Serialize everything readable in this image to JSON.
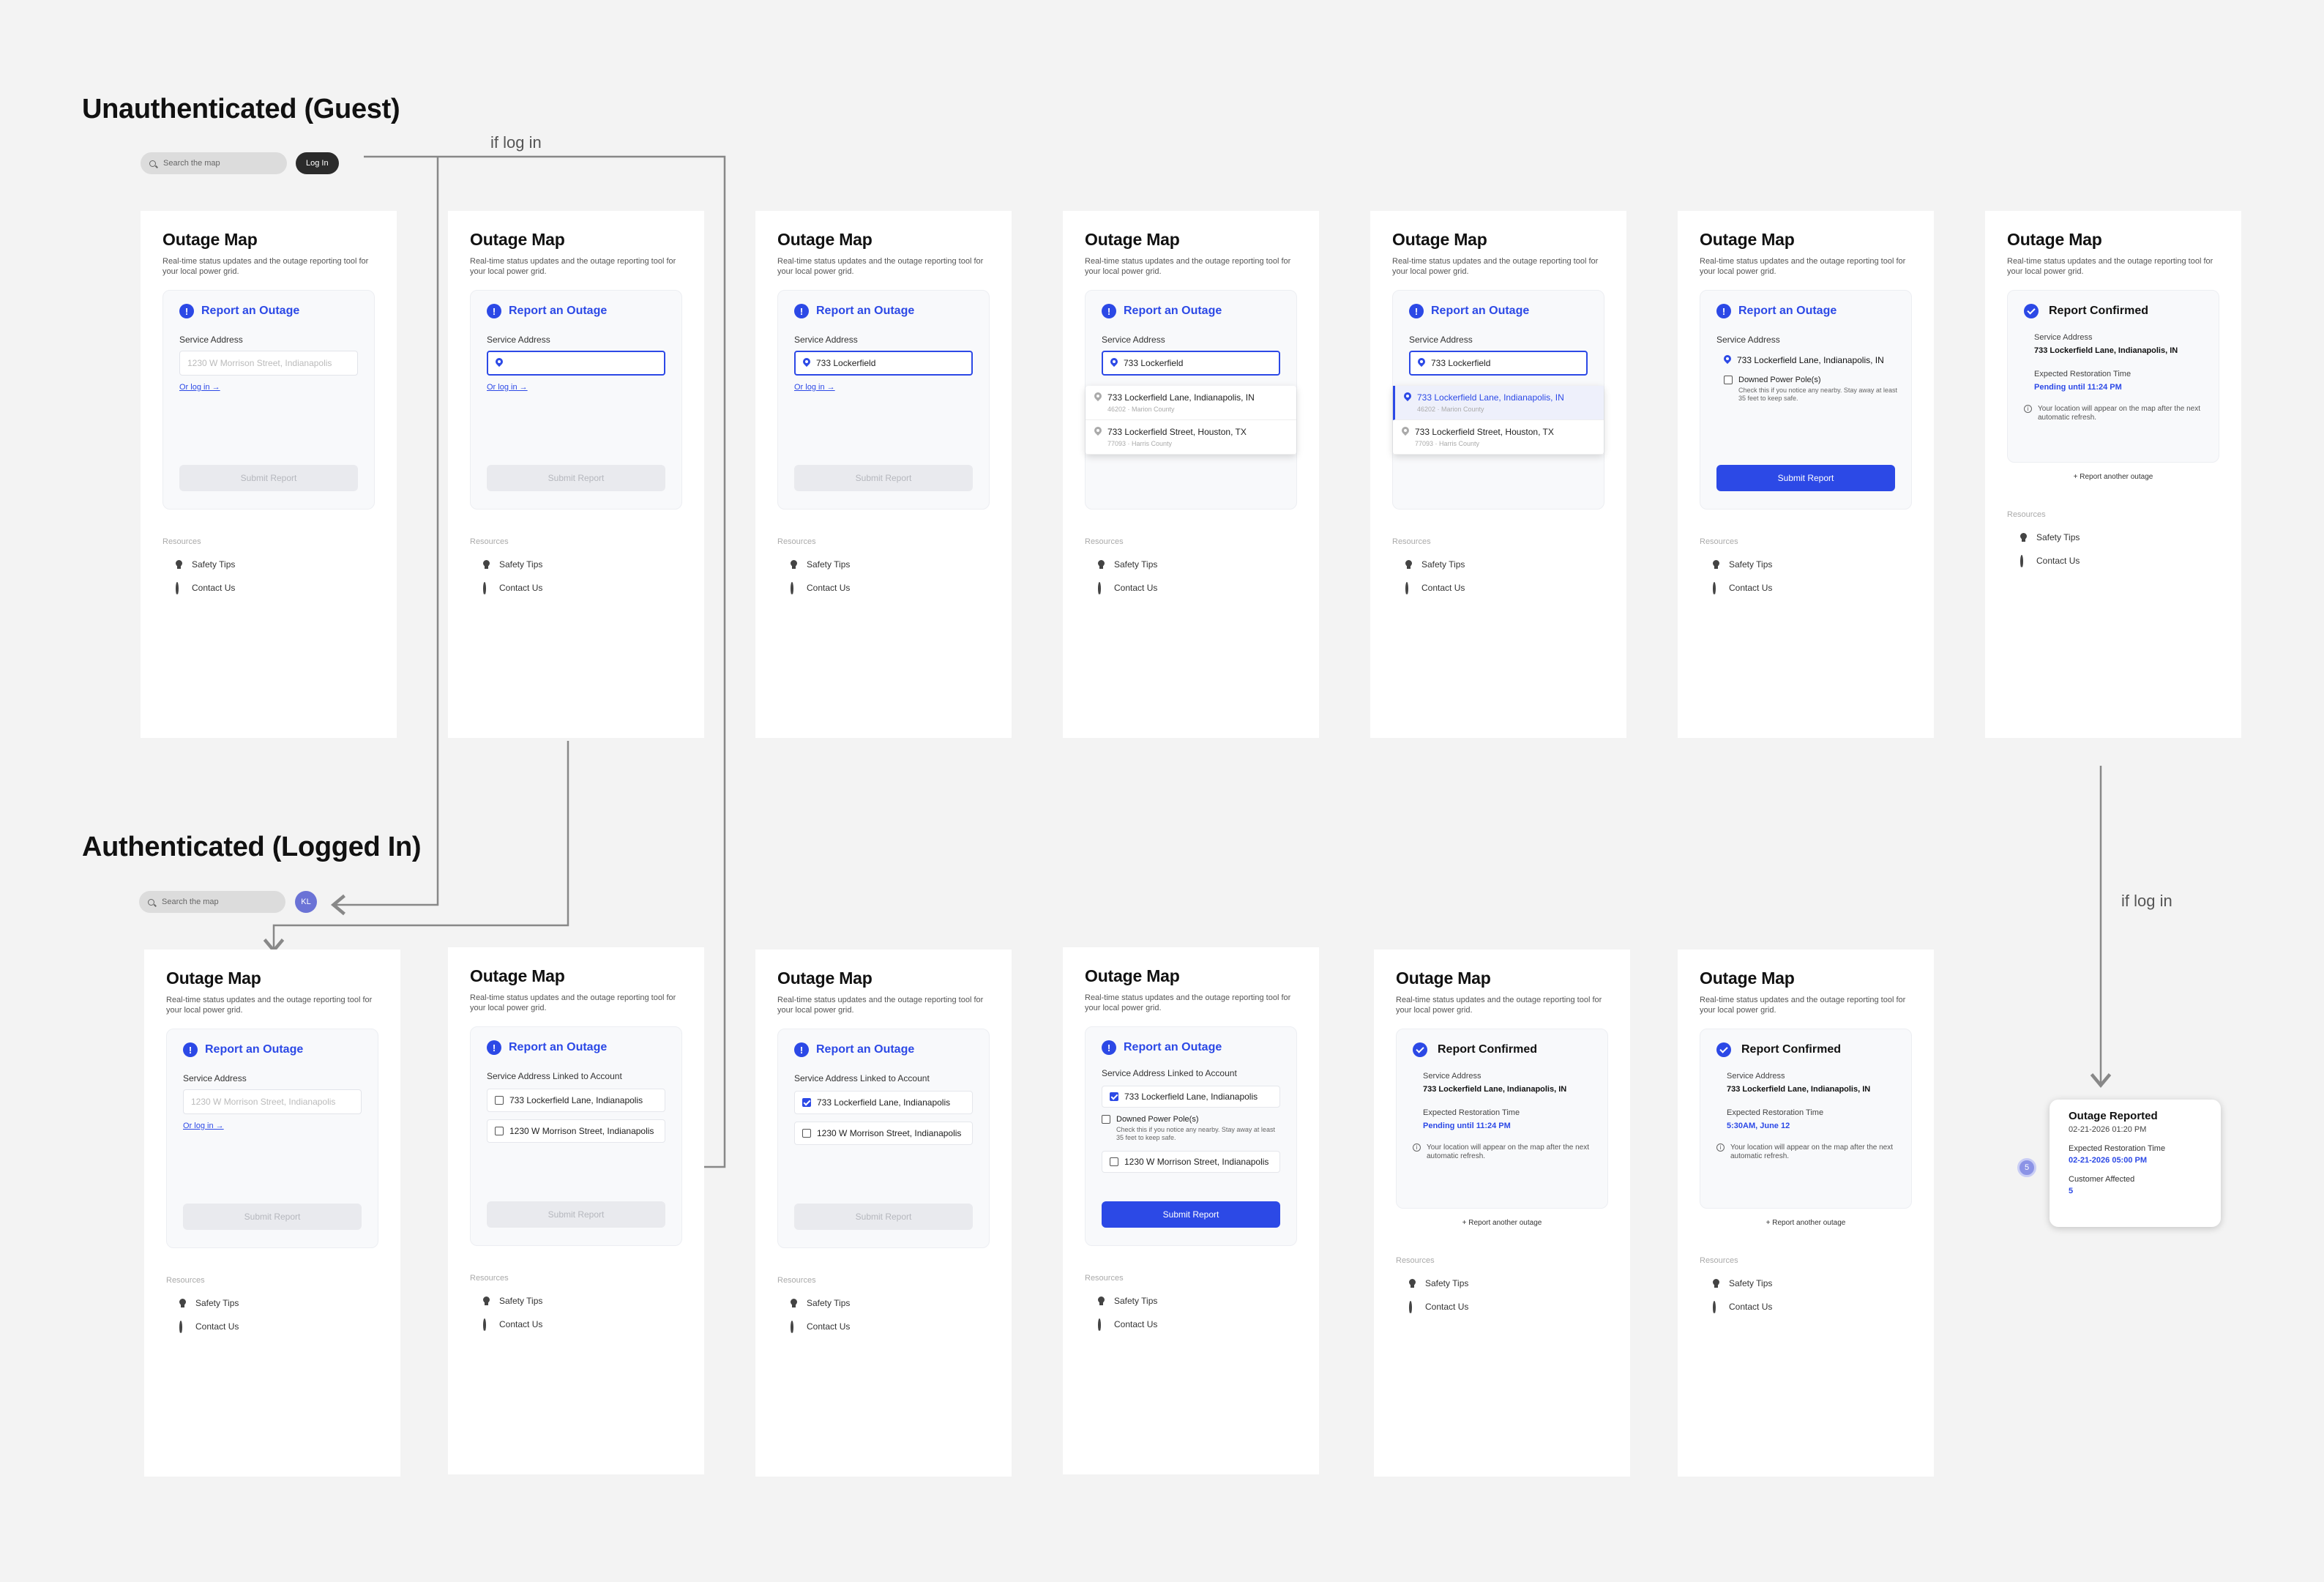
{
  "sections": {
    "guest_title": "Unauthenticated (Guest)",
    "auth_title": "Authenticated (Logged In)"
  },
  "flow_labels": {
    "top": "if log in",
    "right": "if log in"
  },
  "topbar": {
    "search_placeholder": "Search the map",
    "login_label": "Log In",
    "avatar_initials": "KL"
  },
  "common": {
    "app_title": "Outage Map",
    "subtitle": "Real-time status updates and the outage reporting tool for your local power grid.",
    "report_title": "Report an Outage",
    "service_address_label": "Service Address",
    "linked_label": "Service Address Linked to Account",
    "address_placeholder": "1230 W Morrison Street, Indianapolis",
    "or_login": "Or log in →",
    "submit_label": "Submit Report",
    "resources_label": "Resources",
    "safety_tips": "Safety Tips",
    "contact_us": "Contact Us",
    "typed_query": "733 Lockerfield",
    "suggestion1_main": "733 Lockerfield Lane, Indianapolis, IN",
    "suggestion1_sub": "46202 · Marion County",
    "suggestion2_main": "733 Lockerfield Street, Houston, TX",
    "suggestion2_sub": "77093 · Harris County",
    "selected_address": "733 Lockerfield Lane, Indianapolis, IN",
    "downed_pole": "Downed Power Pole(s)",
    "downed_hint": "Check this if you notice any nearby. Stay away at least 35 feet to keep safe.",
    "linked_addr1": "733 Lockerfield Lane, Indianapolis",
    "linked_addr2": "1230 W Morrison Street, Indianapolis",
    "confirmed_title": "Report Confirmed",
    "expected_label": "Expected Restoration Time",
    "pending": "Pending until 11:24 PM",
    "restore_time2": "5:30AM, June 12",
    "info_text": "Your location will appear on the map after the next automatic refresh.",
    "report_another": "+ Report another outage"
  },
  "popup": {
    "title": "Outage Reported",
    "timestamp": "02-21-2026 01:20 PM",
    "expected_label": "Expected Restoration Time",
    "expected_value": "02-21-2026 05:00 PM",
    "customers_label": "Customer Affected",
    "customers_value": "5",
    "badge": "5"
  },
  "colors": {
    "accent": "#2c49e6",
    "background": "#f3f3f3"
  }
}
